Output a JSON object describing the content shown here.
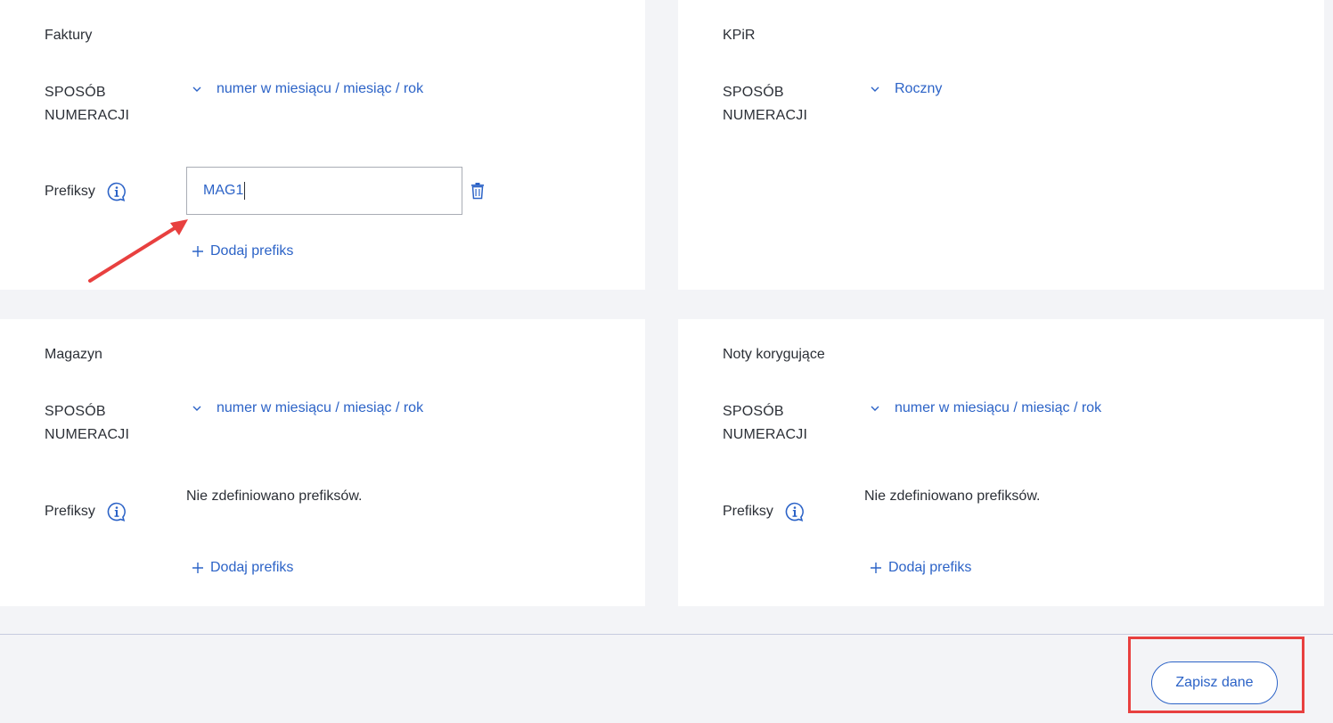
{
  "cards": {
    "faktury": {
      "title": "Faktury",
      "numbering_label_1": "SPOSÓB",
      "numbering_label_2": "NUMERACJI",
      "numbering_value": "numer w miesiącu / miesiąc / rok",
      "prefixes_label": "Prefiksy",
      "prefix_input_value": "MAG1",
      "add_prefix_label": "Dodaj prefiks"
    },
    "kpir": {
      "title": "KPiR",
      "numbering_label_1": "SPOSÓB",
      "numbering_label_2": "NUMERACJI",
      "numbering_value": "Roczny"
    },
    "magazyn": {
      "title": "Magazyn",
      "numbering_label_1": "SPOSÓB",
      "numbering_label_2": "NUMERACJI",
      "numbering_value": "numer w miesiącu / miesiąc / rok",
      "prefixes_label": "Prefiksy",
      "empty_prefixes": "Nie zdefiniowano prefiksów.",
      "add_prefix_label": "Dodaj prefiks"
    },
    "noty": {
      "title": "Noty korygujące",
      "numbering_label_1": "SPOSÓB",
      "numbering_label_2": "NUMERACJI",
      "numbering_value": "numer w miesiącu / miesiąc / rok",
      "prefixes_label": "Prefiksy",
      "empty_prefixes": "Nie zdefiniowano prefiksów.",
      "add_prefix_label": "Dodaj prefiks"
    }
  },
  "footer": {
    "save_label": "Zapisz dane"
  },
  "icons": {
    "chevron": "chevron-down-icon",
    "info": "info-icon",
    "trash": "trash-icon",
    "plus": "plus-icon"
  },
  "colors": {
    "accent": "#2c63c7",
    "annotation": "#e8403f",
    "background": "#f3f4f7",
    "card": "#ffffff"
  }
}
